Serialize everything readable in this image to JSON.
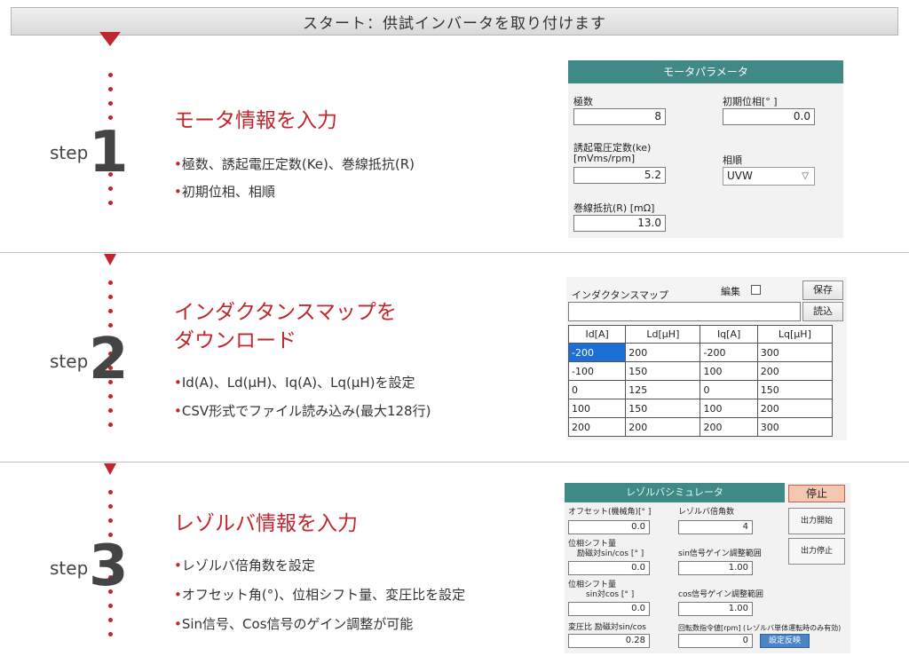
{
  "banner": "スタート：供試インバータを取り付けます",
  "step_word": "step",
  "steps": [
    {
      "number": "1",
      "title": "モータ情報を入力",
      "bullets": [
        "極数、誘起電圧定数(Ke)、巻線抵抗(R)",
        "初期位相、相順"
      ]
    },
    {
      "number": "2",
      "title_line1": "インダクタンスマップを",
      "title_line2": "ダウンロード",
      "bullets": [
        "Id(A)、Ld(μH)、Iq(A)、Lq(μH)を設定",
        "CSV形式でファイル読み込み(最大128行)"
      ]
    },
    {
      "number": "3",
      "title": "レゾルバ情報を入力",
      "bullets": [
        "レゾルバ倍角数を設定",
        "オフセット角(°)、位相シフト量、変圧比を設定",
        "Sin信号、Cos信号のゲイン調整が可能"
      ]
    }
  ],
  "bullet_marker": "•",
  "motor_panel": {
    "title": "モータパラメータ",
    "poles_label": "極数",
    "poles_value": "8",
    "initial_phase_label": "初期位相[° ]",
    "initial_phase_value": "0.0",
    "ke_label_1": "誘起電圧定数(ke)",
    "ke_label_2": "[mVms/rpm]",
    "ke_value": "5.2",
    "phase_order_label": "相順",
    "phase_order_value": "UVW",
    "resistance_label": "巻線抵抗(R) [mΩ]",
    "resistance_value": "13.0"
  },
  "inductance_panel": {
    "title": "インダクタンスマップ",
    "edit_label": "編集",
    "save_button": "保存",
    "load_button": "読込",
    "file_path": "",
    "columns": [
      "Id[A]",
      "Ld[μH]",
      "Iq[A]",
      "Lq[μH]"
    ],
    "rows": [
      [
        "-200",
        "200",
        "-200",
        "300"
      ],
      [
        "-100",
        "150",
        "100",
        "200"
      ],
      [
        "0",
        "125",
        "0",
        "150"
      ],
      [
        "100",
        "150",
        "100",
        "200"
      ],
      [
        "200",
        "200",
        "200",
        "300"
      ]
    ]
  },
  "resolver_panel": {
    "title": "レゾルバシミュレータ",
    "stop_button": "停止",
    "output_start_button": "出力開始",
    "output_stop_button": "出力停止",
    "offset_label": "オフセット(機械角)[° ]",
    "offset_value": "0.0",
    "multiplier_label": "レゾルバ倍角数",
    "multiplier_value": "4",
    "phase_shift1_label_1": "位相シフト量",
    "phase_shift1_label_2": "励磁対sin/cos [° ]",
    "phase_shift1_value": "0.0",
    "sin_gain_label": "sin信号ゲイン調整範囲",
    "sin_gain_value": "1.00",
    "phase_shift2_label_1": "位相シフト量",
    "phase_shift2_label_2": "sin対cos [° ]",
    "phase_shift2_value": "0.0",
    "cos_gain_label": "cos信号ゲイン調整範囲",
    "cos_gain_value": "1.00",
    "ratio_label": "変圧比 励磁対sin/cos",
    "ratio_value": "0.28",
    "speed_label": "回転数指令値[rpm] (レゾルバ単体運転時のみ有効)",
    "speed_value": "0",
    "apply_button": "設定反映"
  }
}
